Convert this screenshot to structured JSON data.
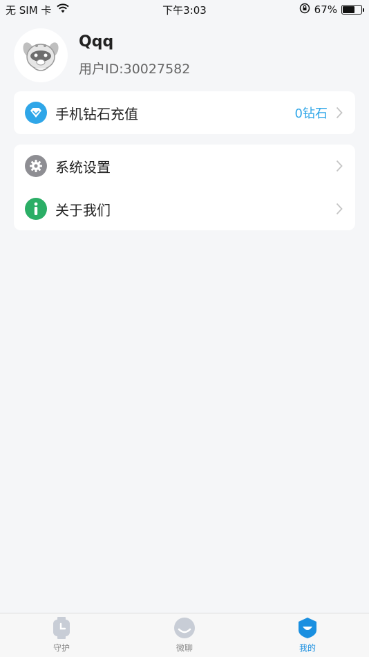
{
  "status_bar": {
    "carrier": "无 SIM 卡",
    "time": "下午3:03",
    "battery_percent": "67%",
    "battery_level": 0.67
  },
  "profile": {
    "username": "Qqq",
    "user_id": "用户ID:30027582"
  },
  "menu": {
    "recharge": {
      "label": "手机钻石充值",
      "value": "0钻石"
    },
    "settings": {
      "label": "系统设置"
    },
    "about": {
      "label": "关于我们"
    }
  },
  "tabs": [
    {
      "label": "守护",
      "icon": "watch-icon",
      "active": false
    },
    {
      "label": "微聊",
      "icon": "smile-chat-icon",
      "active": false
    },
    {
      "label": "我的",
      "icon": "profile-shield-icon",
      "active": true
    }
  ],
  "colors": {
    "accent": "#1a8fe0",
    "diamond_icon": "#2fa6e8",
    "settings_icon": "#8e8e93",
    "info_icon": "#2bae66",
    "background": "#f5f6f8"
  }
}
